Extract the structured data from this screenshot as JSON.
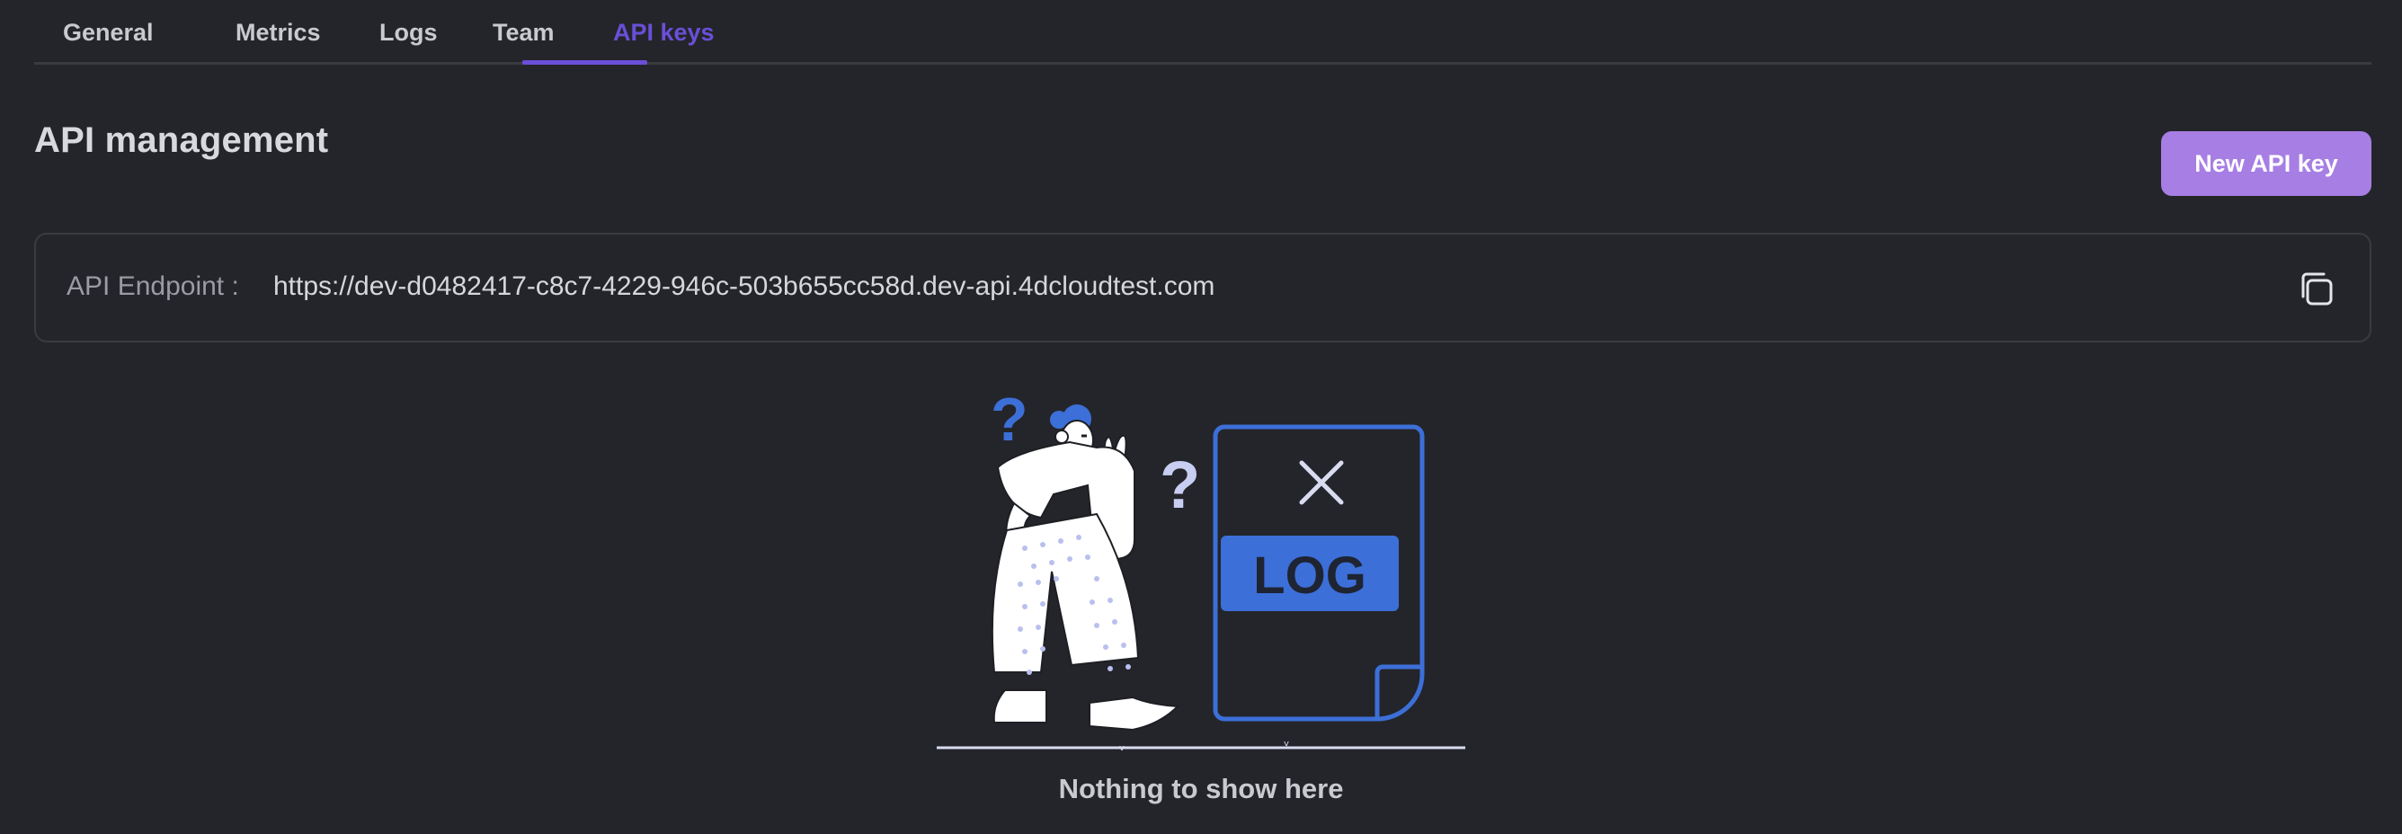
{
  "tabs": [
    {
      "label": "General",
      "active": false
    },
    {
      "label": "Metrics",
      "active": false
    },
    {
      "label": "Logs",
      "active": false
    },
    {
      "label": "Team",
      "active": false
    },
    {
      "label": "API keys",
      "active": true
    }
  ],
  "header": {
    "title": "API management",
    "new_key_label": "New API key"
  },
  "endpoint": {
    "label": "API Endpoint :",
    "url": "https://dev-d0482417-c8c7-4229-946c-503b655cc58d.dev-api.4dcloudtest.com",
    "copy_icon": "copy-icon"
  },
  "empty_state": {
    "message": "Nothing to show here",
    "document_label": "LOG",
    "illustration": "confused-person-missing-log"
  },
  "colors": {
    "background": "#24252a",
    "accent": "#6a4fd8",
    "button": "#a77ee3",
    "illustration_blue": "#3c6fd8"
  }
}
